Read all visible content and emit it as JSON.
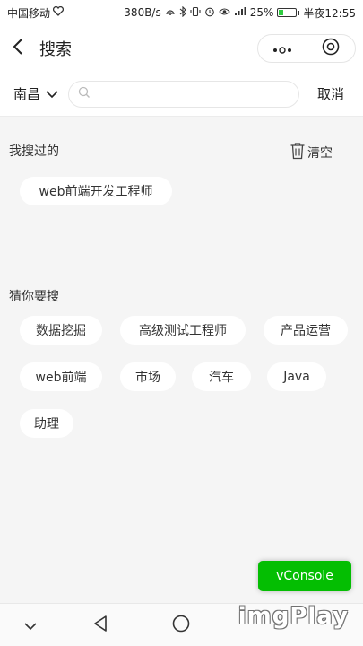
{
  "status_bar": {
    "carrier": "中国移动",
    "speed": "380B/s",
    "battery": "25%",
    "battery_level": 0.25,
    "time": "半夜12:55"
  },
  "nav": {
    "title": "搜索"
  },
  "search": {
    "city": "南昌",
    "value": "",
    "placeholder": "",
    "cancel_label": "取消"
  },
  "history": {
    "title": "我搜过的",
    "clear_label": "清空",
    "items": [
      "web前端开发工程师"
    ]
  },
  "suggestions": {
    "title": "猜你要搜",
    "items": [
      "数据挖掘",
      "高级测试工程师",
      "产品运营",
      "web前端",
      "市场",
      "汽车",
      "Java",
      "助理"
    ]
  },
  "vconsole": {
    "label": "vConsole",
    "color": "#04be02"
  },
  "watermark": "imgPlay",
  "icons": [
    "heart-icon",
    "nfc-icon",
    "bluetooth-icon",
    "vibrate-icon",
    "alarm-icon",
    "eye-icon",
    "signal-icon",
    "battery-icon",
    "back-icon",
    "more-icon",
    "target-icon",
    "chevron-down-icon",
    "search-icon",
    "trash-icon",
    "nav-down-icon",
    "nav-back-icon",
    "nav-home-icon"
  ]
}
